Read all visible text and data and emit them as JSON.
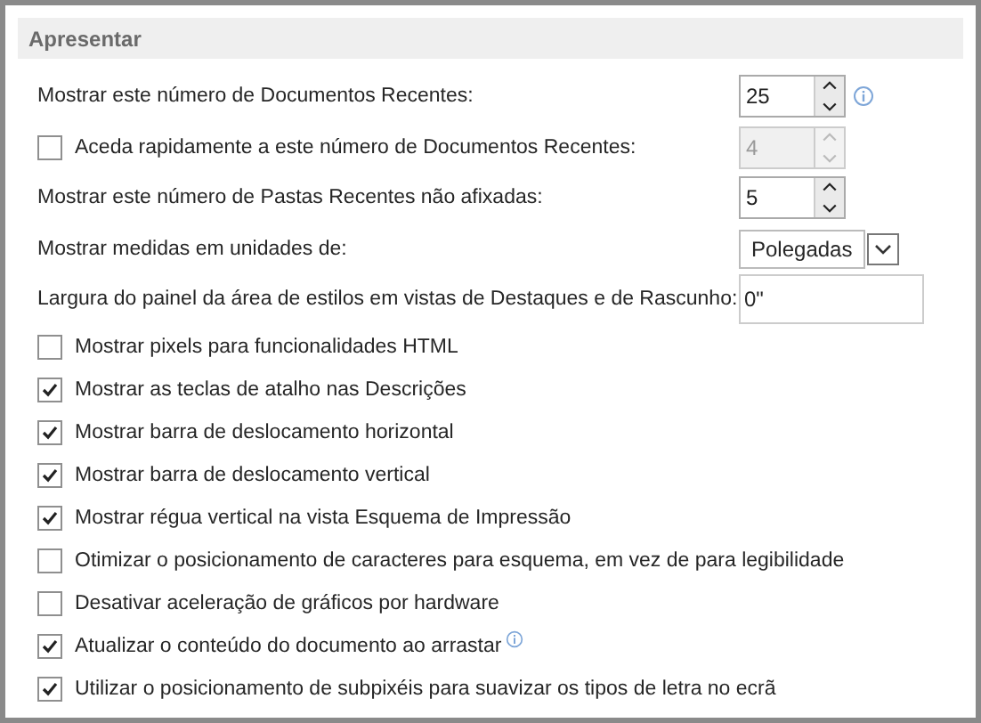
{
  "section": {
    "title": "Apresentar"
  },
  "settings": [
    {
      "kind": "spinner",
      "label": "Mostrar este número de Documentos Recentes:",
      "value": "25",
      "disabled": false,
      "info": true
    },
    {
      "kind": "checkbox_spinner",
      "label": "Aceda rapidamente a este número de Documentos Recentes:",
      "checked": false,
      "value": "4",
      "disabled": true,
      "info": false
    },
    {
      "kind": "spinner",
      "label": "Mostrar este número de Pastas Recentes não afixadas:",
      "value": "5",
      "disabled": false,
      "info": false
    },
    {
      "kind": "dropdown",
      "label": "Mostrar medidas em unidades de:",
      "value": "Polegadas"
    },
    {
      "kind": "text",
      "label": "Largura do painel da área de estilos em vistas de Destaques e de Rascunho:",
      "value": "0\""
    }
  ],
  "options": [
    {
      "label": "Mostrar pixels para funcionalidades HTML",
      "checked": false,
      "info": false
    },
    {
      "label": "Mostrar as teclas de atalho nas Descrições",
      "checked": true,
      "info": false
    },
    {
      "label": "Mostrar barra de deslocamento horizontal",
      "checked": true,
      "info": false
    },
    {
      "label": "Mostrar barra de deslocamento vertical",
      "checked": true,
      "info": false
    },
    {
      "label": "Mostrar régua vertical na vista Esquema de Impressão",
      "checked": true,
      "info": false
    },
    {
      "label": "Otimizar o posicionamento de caracteres para esquema, em vez de para legibilidade",
      "checked": false,
      "info": false
    },
    {
      "label": "Desativar aceleração de gráficos por hardware",
      "checked": false,
      "info": false
    },
    {
      "label": "Atualizar o conteúdo do documento ao arrastar",
      "checked": true,
      "info": true
    },
    {
      "label": "Utilizar o posicionamento de subpixéis para suavizar os tipos de letra no ecrã",
      "checked": true,
      "info": false
    }
  ]
}
